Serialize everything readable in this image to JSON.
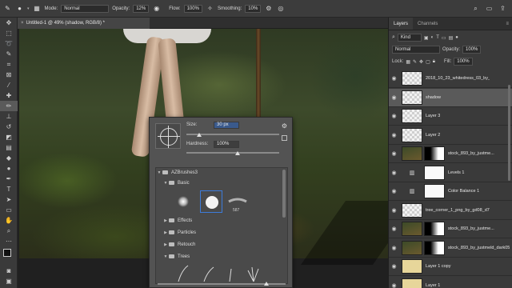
{
  "options_bar": {
    "mode_label": "Mode:",
    "mode_value": "Normal",
    "opacity_label": "Opacity:",
    "opacity_value": "12%",
    "flow_label": "Flow:",
    "flow_value": "100%",
    "smoothing_label": "Smoothing:",
    "smoothing_value": "10%"
  },
  "document_tab": {
    "title": "Untitled-1 @ 49% (shadow, RGB/8) *"
  },
  "brush_panel": {
    "size_label": "Size:",
    "size_value": "30 px",
    "hardness_label": "Hardness:",
    "hardness_value": "100%",
    "groups": [
      {
        "label": "AZBrushes3",
        "expanded": true
      },
      {
        "label": "Basic",
        "expanded": true
      },
      {
        "label": "Effects",
        "expanded": false
      },
      {
        "label": "Particles",
        "expanded": false
      },
      {
        "label": "Retouch",
        "expanded": false
      },
      {
        "label": "Trees",
        "expanded": true
      }
    ],
    "brush_size_label": "587"
  },
  "layers_panel": {
    "tabs": [
      "Layers",
      "Channels"
    ],
    "filter_value": "Kind",
    "blend_mode": "Normal",
    "opacity_label": "Opacity:",
    "opacity_value": "100%",
    "lock_label": "Lock:",
    "fill_label": "Fill:",
    "fill_value": "100%",
    "layers": [
      {
        "name": "2018_10_23_whitedress_03_by_skyd...",
        "thumb": "checker",
        "selected": false
      },
      {
        "name": "shadow",
        "thumb": "checker",
        "selected": true
      },
      {
        "name": "Layer 3",
        "thumb": "checker",
        "selected": false
      },
      {
        "name": "Layer 2",
        "thumb": "checker",
        "selected": false
      },
      {
        "name": "stock_893_by_justme...",
        "thumb": "photo",
        "selected": false
      },
      {
        "name": "Levels 1",
        "thumb": "adjustment",
        "selected": false
      },
      {
        "name": "Color Balance 1",
        "thumb": "adjustment",
        "selected": false
      },
      {
        "name": "tree_corner_1_png_by_gd08_d7yxb6a",
        "thumb": "checker",
        "selected": false
      },
      {
        "name": "stock_893_by_justme...",
        "thumb": "photo",
        "selected": false
      },
      {
        "name": "stock_893_by_justmeld_dark05",
        "thumb": "photo",
        "selected": false
      },
      {
        "name": "Layer 1 copy",
        "thumb": "yellow",
        "selected": false
      },
      {
        "name": "Layer 1",
        "thumb": "yellow",
        "selected": false
      }
    ]
  }
}
